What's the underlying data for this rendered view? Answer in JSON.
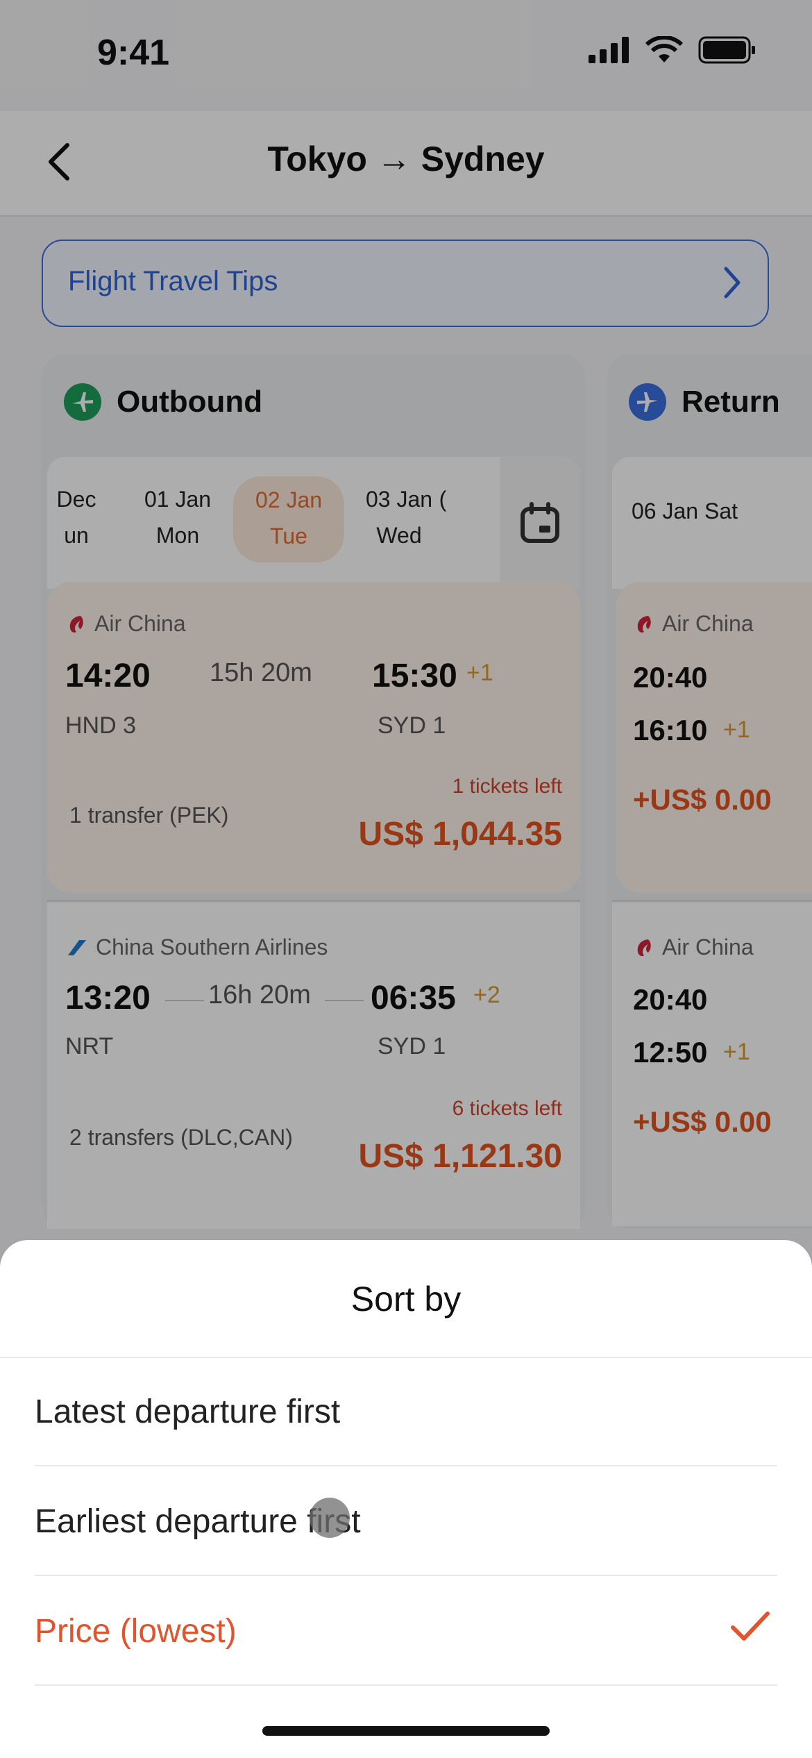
{
  "status": {
    "time": "9:41"
  },
  "header": {
    "title": "Tokyo → Sydney"
  },
  "tips": {
    "label": "Flight Travel Tips"
  },
  "outbound": {
    "title": "Outbound",
    "dates": [
      {
        "top": "Dec",
        "bottom": "un"
      },
      {
        "top": "01 Jan",
        "bottom": "Mon"
      },
      {
        "top": "02 Jan",
        "bottom": "Tue"
      },
      {
        "top": "03 Jan",
        "bottom": "Wed"
      },
      {
        "top": "(",
        "bottom": ""
      }
    ],
    "flights": [
      {
        "airline": "Air China",
        "dep": "14:20",
        "duration": "15h 20m",
        "arr": "15:30",
        "plus": "+1",
        "from": "HND 3",
        "to": "SYD 1",
        "tickets": "1 tickets left",
        "transfer": "1 transfer (PEK)",
        "price": "US$ 1,044.35"
      },
      {
        "airline": "China Southern Airlines",
        "dep": "13:20",
        "duration": "16h 20m",
        "arr": "06:35",
        "plus": "+2",
        "from": "NRT",
        "to": "SYD 1",
        "tickets": "6 tickets left",
        "transfer": "2 transfers (DLC,CAN)",
        "price": "US$ 1,121.30"
      }
    ]
  },
  "return": {
    "title": "Return",
    "date": "06 Jan Sat",
    "flights": [
      {
        "airline": "Air China",
        "dep": "20:40",
        "arr": "16:10",
        "plus": "+1",
        "price": "+US$ 0.00"
      },
      {
        "airline": "Air China",
        "dep": "20:40",
        "arr": "12:50",
        "plus": "+1",
        "price": "+US$ 0.00"
      }
    ]
  },
  "sort_sheet": {
    "title": "Sort by",
    "options": [
      {
        "label": "Latest departure first",
        "selected": false
      },
      {
        "label": "Earliest departure first",
        "selected": false
      },
      {
        "label": "Price (lowest)",
        "selected": true
      }
    ]
  },
  "colors": {
    "accent": "#e0542e",
    "link": "#2f64d6",
    "outbound_icon": "#1e9e5a",
    "return_icon": "#3b6fe0"
  }
}
